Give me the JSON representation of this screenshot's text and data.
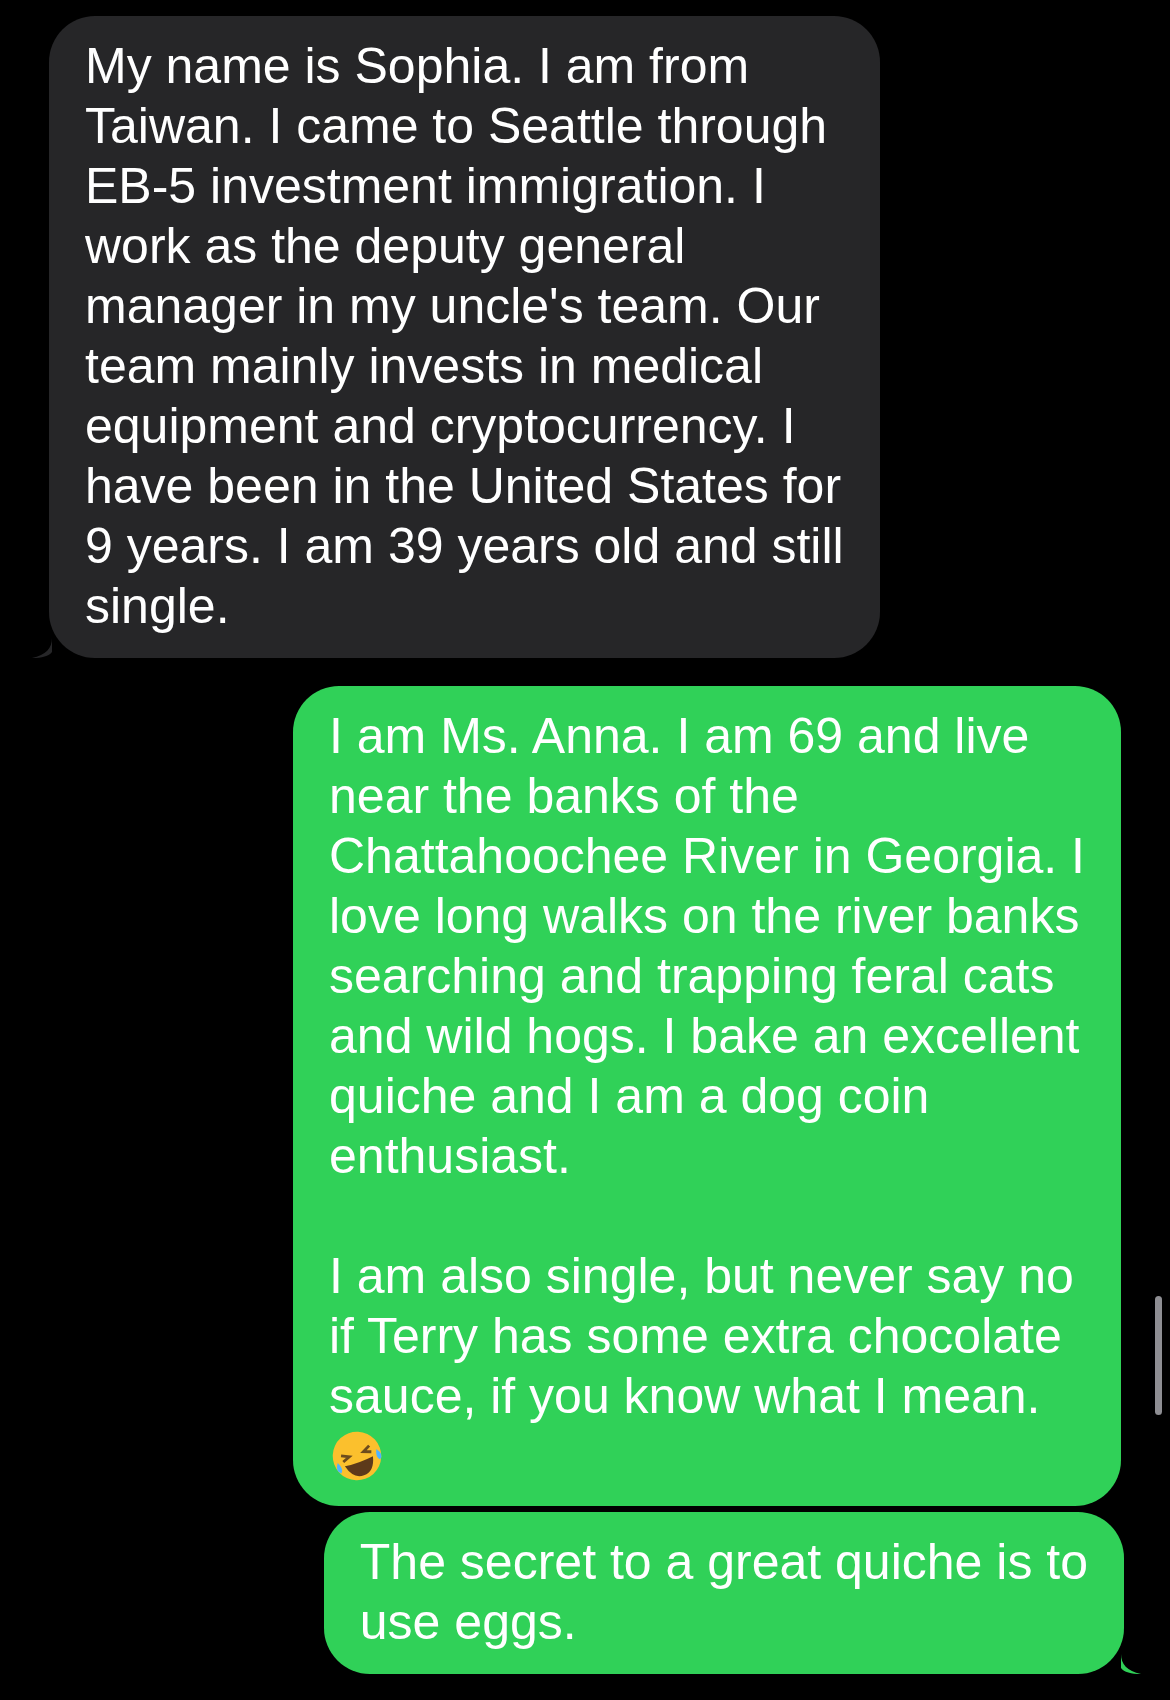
{
  "messages": [
    {
      "kind": "received",
      "tail": true,
      "paragraphs": [
        [
          "My name is Sophia. I am from",
          "Taiwan. I came to Seattle through",
          "EB-5 investment immigration. I",
          "work as the deputy general",
          "manager in my uncle's team. Our",
          "team mainly invests in medical",
          "equipment and cryptocurrency. I",
          "have been in the United States for",
          "9 years. I am 39 years old and still",
          "single."
        ]
      ]
    },
    {
      "kind": "sent",
      "tail": false,
      "paragraphs": [
        [
          "I am Ms. Anna. I am 69 and live",
          "near the banks of the",
          "Chattahoochee River in Georgia. I",
          "love long walks on the river banks",
          "searching and trapping feral cats",
          "and wild hogs. I bake an excellent",
          "quiche and I am a dog coin",
          "enthusiast."
        ],
        [
          "I am also single, but never say no",
          "if Terry has some extra chocolate",
          "sauce, if you know what I mean."
        ]
      ],
      "emoji": true
    },
    {
      "kind": "sent",
      "tail": true,
      "paragraphs": [
        [
          "The secret to a great quiche is to",
          "use eggs."
        ]
      ]
    }
  ]
}
